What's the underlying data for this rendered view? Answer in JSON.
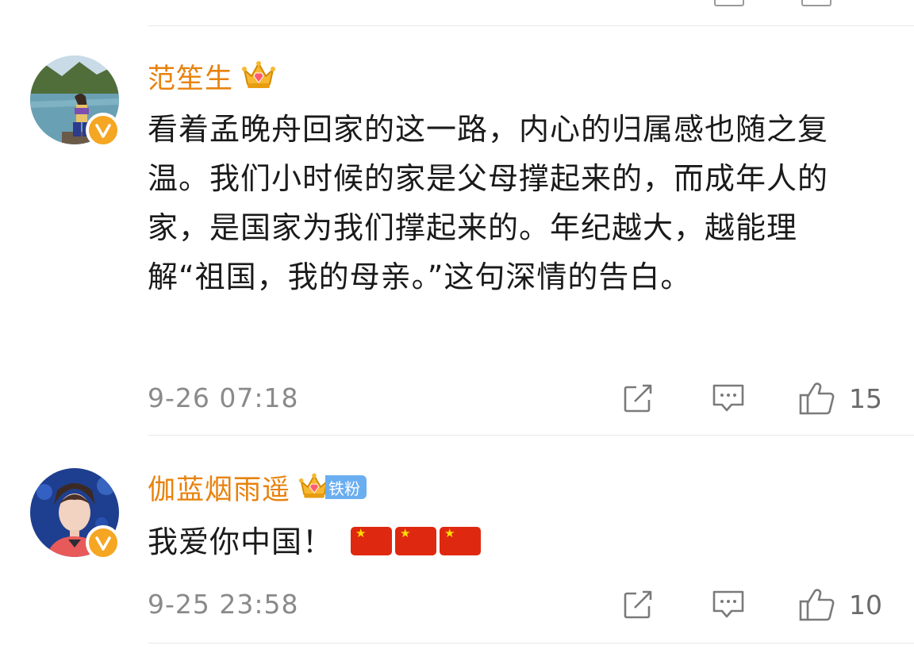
{
  "comments": [
    {
      "username": "范笙生",
      "text": "看着孟晚舟回家的这一路，内心的归属感也随之复温。我们小时候的家是父母撑起来的，而成年人的家，是国家为我们撑起来的。年纪越大，越能理解“祖国，我的母亲。”这句深情的告白。",
      "time": "9-26 07:18",
      "likes": "15"
    },
    {
      "username": "伽蓝烟雨遥",
      "fan_badge": "铁粉",
      "text": "我爱你中国！",
      "time": "9-25 23:58",
      "likes": "10"
    }
  ],
  "icons": [
    "repost-icon",
    "comment-icon",
    "like-icon",
    "verified-badge-icon",
    "crown-vip-icon",
    "china-flag-emoji"
  ],
  "colors": {
    "username": "#e8820e",
    "verified_badge": "#f5a623",
    "fan_badge": "#6aaef0",
    "meta_text": "#8a8a8a",
    "divider": "#e8e8e8"
  }
}
